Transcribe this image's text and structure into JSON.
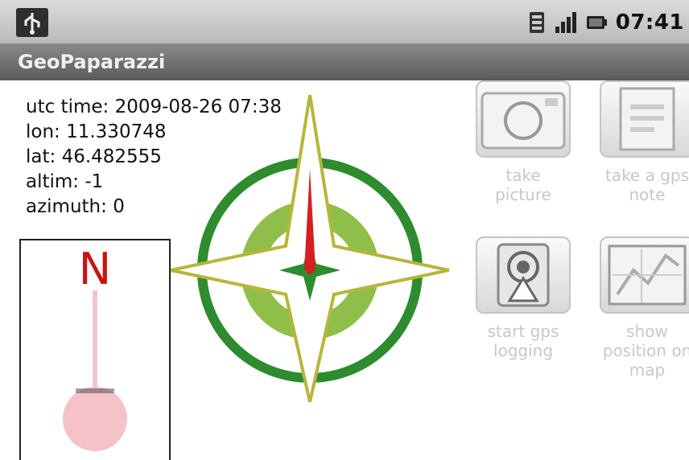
{
  "status_bar": {
    "time": "07:41",
    "icons": [
      "usb-icon",
      "sdcard-icon",
      "signal-icon",
      "battery-icon"
    ]
  },
  "app": {
    "title": "GeoPaparazzi"
  },
  "info": {
    "utc_time": "utc time: 2009-08-26 07:38",
    "lon": "lon: 11.330748",
    "lat": "lat: 46.482555",
    "altim": "altim: -1",
    "azimuth": "azimuth: 0"
  },
  "level": {
    "north_label": "N"
  },
  "actions": [
    {
      "label_line1": "take",
      "label_line2": "picture",
      "label_line3": "",
      "icon": "camera-icon"
    },
    {
      "label_line1": "take a gps",
      "label_line2": "note",
      "label_line3": "",
      "icon": "note-icon"
    },
    {
      "label_line1": "start gps",
      "label_line2": "logging",
      "label_line3": "",
      "icon": "gps-logging-icon"
    },
    {
      "label_line1": "show",
      "label_line2": "position on",
      "label_line3": "map",
      "icon": "map-icon"
    }
  ],
  "colors": {
    "compass_green": "#2e8b2e",
    "compass_light_green": "#8fbf4a",
    "compass_needle_red": "#d42020",
    "north_red": "#cc1111",
    "bubble_pink": "#f5c2c7"
  }
}
